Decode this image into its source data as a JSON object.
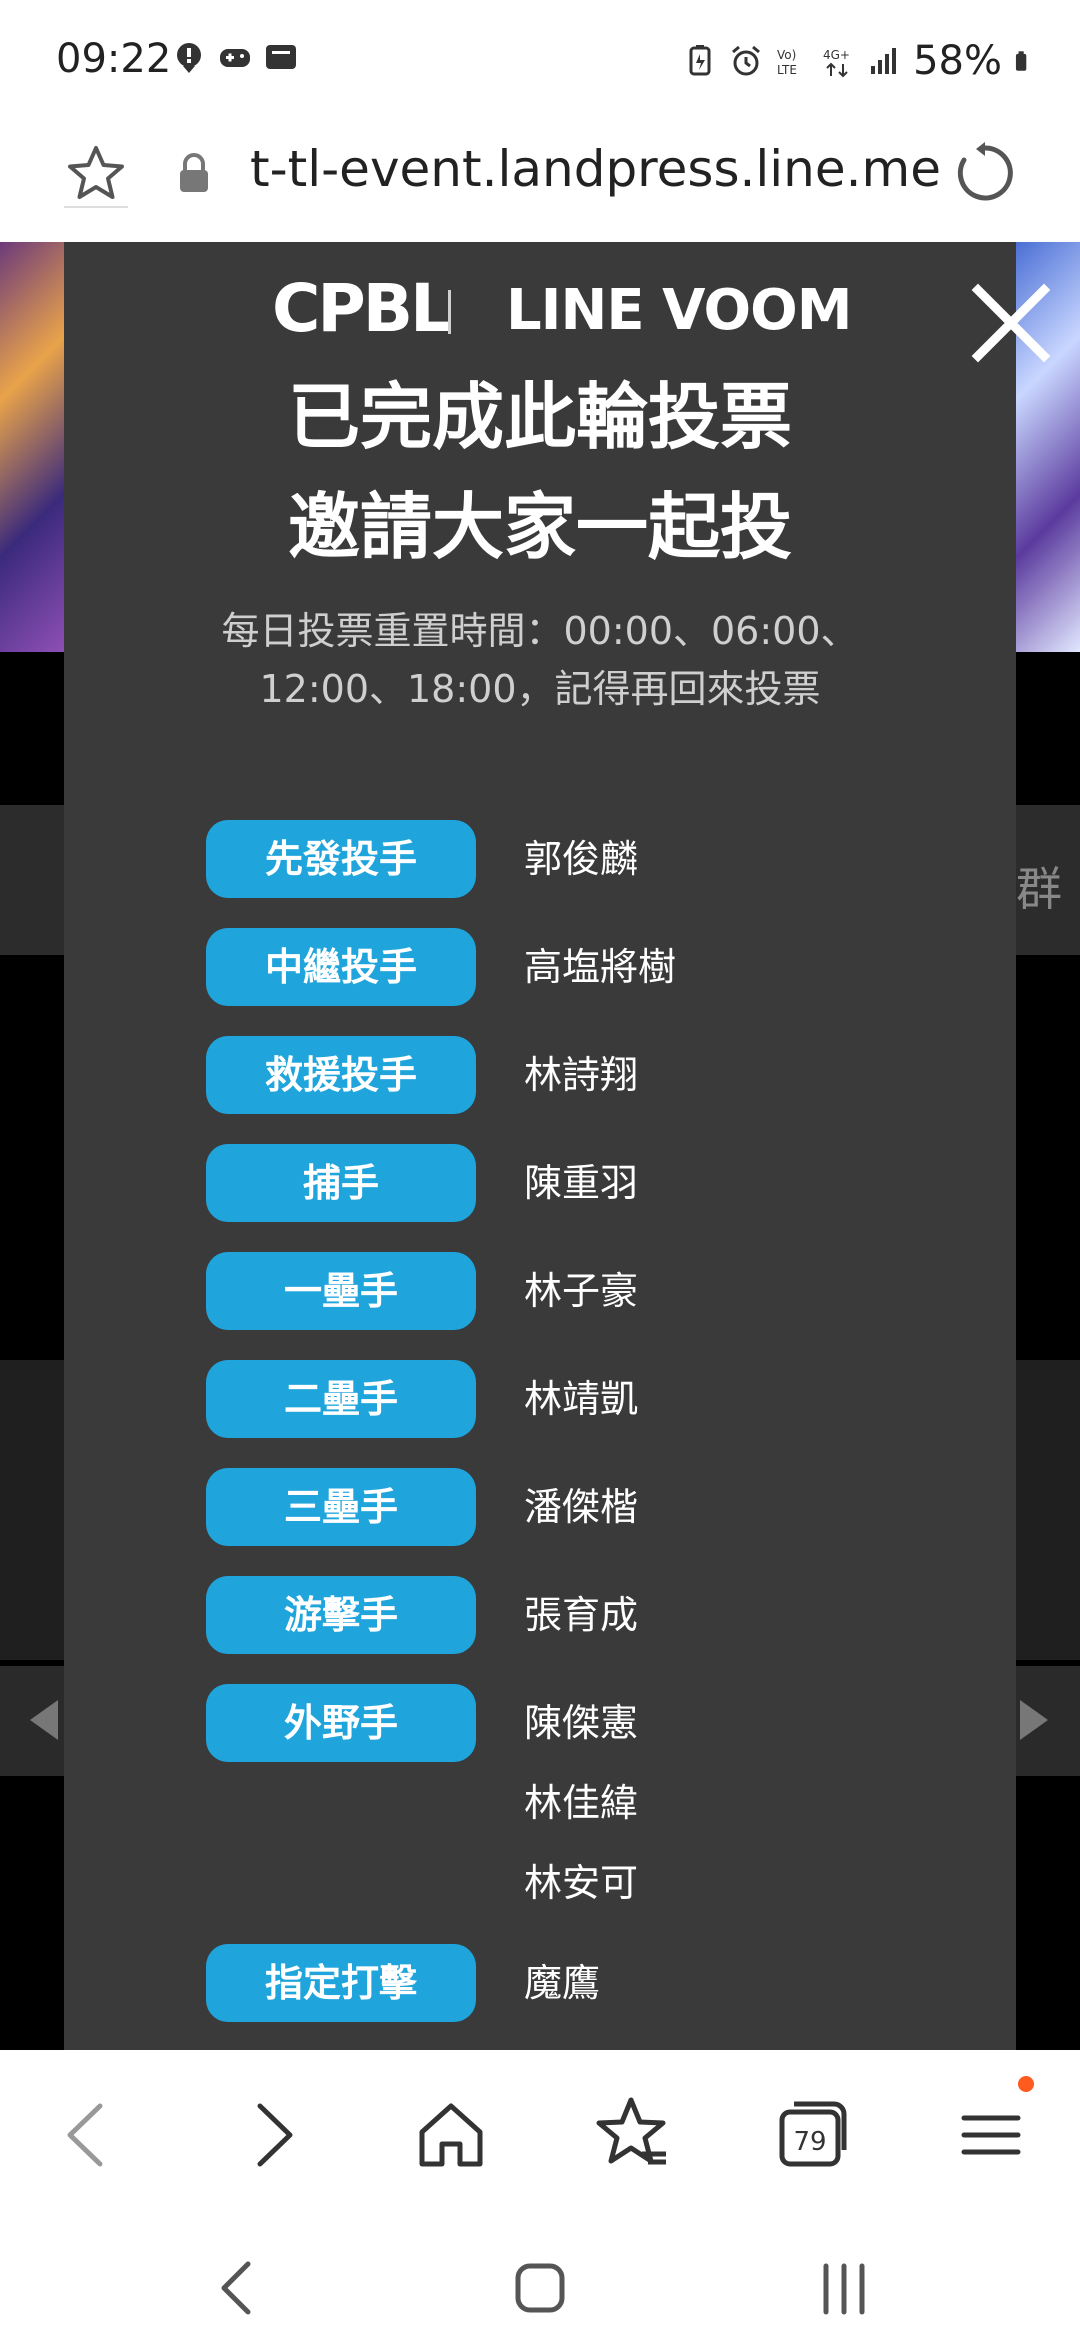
{
  "status_bar": {
    "time": "09:22",
    "battery": "58%",
    "icons_left": [
      "location-alert-icon",
      "game-controller-icon",
      "tablet-icon"
    ],
    "icons_right": [
      "battery-saver-icon",
      "alarm-icon",
      "volte-icon",
      "4g-plus-icon",
      "signal-icon",
      "battery-icon"
    ]
  },
  "url_bar": {
    "url": "t-tl-event.landpress.line.me"
  },
  "background_page": {
    "right_band_text": "群"
  },
  "modal": {
    "logo_left": "CPBL",
    "logo_right": "LINE VOOM",
    "title_line1": "已完成此輪投票",
    "title_line2": "邀請大家一起投",
    "subtitle": "每日投票重置時間：00:00、06:00、12:00、18:00，記得再回來投票",
    "positions": [
      {
        "label": "先發投手",
        "players": [
          "郭俊麟"
        ]
      },
      {
        "label": "中繼投手",
        "players": [
          "高塩將樹"
        ]
      },
      {
        "label": "救援投手",
        "players": [
          "林詩翔"
        ]
      },
      {
        "label": "捕手",
        "players": [
          "陳重羽"
        ]
      },
      {
        "label": "一壘手",
        "players": [
          "林子豪"
        ]
      },
      {
        "label": "二壘手",
        "players": [
          "林靖凱"
        ]
      },
      {
        "label": "三壘手",
        "players": [
          "潘傑楷"
        ]
      },
      {
        "label": "游擊手",
        "players": [
          "張育成"
        ]
      },
      {
        "label": "外野手",
        "players": [
          "陳傑憲",
          "林佳緯",
          "林安可"
        ]
      },
      {
        "label": "指定打擊",
        "players": [
          "魔鷹"
        ]
      }
    ],
    "accent_color": "#1fa5dc"
  },
  "browser_nav": {
    "tab_count": "79"
  }
}
